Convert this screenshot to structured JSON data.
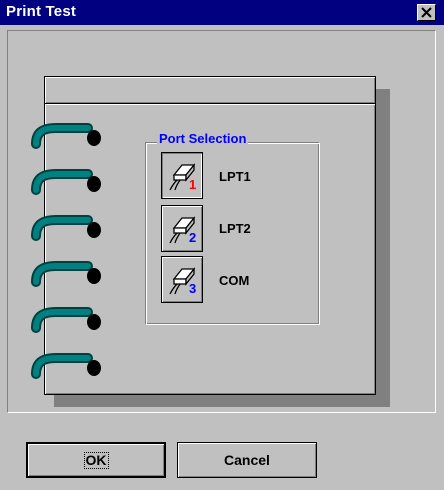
{
  "window": {
    "title": "Print Test"
  },
  "port_selection": {
    "label": "Port Selection",
    "ports": [
      {
        "label": "LPT1",
        "number": "1",
        "number_color": "#ff0000",
        "selected": true
      },
      {
        "label": "LPT2",
        "number": "2",
        "number_color": "#0000ff",
        "selected": false
      },
      {
        "label": "COM",
        "number": "3",
        "number_color": "#0000ff",
        "selected": false
      }
    ]
  },
  "buttons": {
    "ok_label": "OK",
    "cancel_label": "Cancel"
  },
  "icons": {
    "close": "close-icon",
    "port": "printer-cable-icon",
    "rings": "notebook-ring-icon"
  },
  "colors": {
    "titlebar": "#000080",
    "face": "#c0c0c0",
    "group_label": "#0000ff",
    "rings": "#008080"
  }
}
